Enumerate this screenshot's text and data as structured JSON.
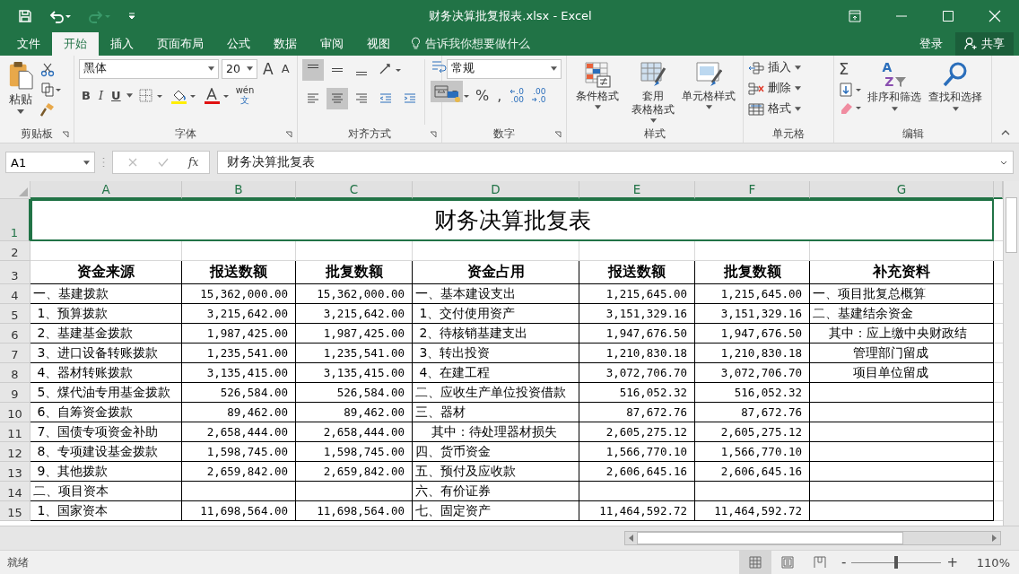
{
  "window": {
    "title": "财务决算批复报表.xlsx - Excel"
  },
  "tabs": [
    {
      "label": "文件",
      "selected": false
    },
    {
      "label": "开始",
      "selected": true
    },
    {
      "label": "插入",
      "selected": false
    },
    {
      "label": "页面布局",
      "selected": false
    },
    {
      "label": "公式",
      "selected": false
    },
    {
      "label": "数据",
      "selected": false
    },
    {
      "label": "审阅",
      "selected": false
    },
    {
      "label": "视图",
      "selected": false
    }
  ],
  "tell_me": {
    "placeholder": "告诉我你想要做什么"
  },
  "account": {
    "sign_in": "登录",
    "share": "共享"
  },
  "ribbon": {
    "clipboard": {
      "label": "剪贴板",
      "paste": "粘贴"
    },
    "font": {
      "label": "字体",
      "font_name": "黑体",
      "font_size": "20",
      "grow": "A",
      "shrink": "A",
      "bold": "B",
      "italic": "I",
      "underline": "U",
      "phonetic_top": "wén",
      "phonetic_bottom": "文"
    },
    "alignment": {
      "label": "对齐方式",
      "top_row": [
        {
          "kind": "top",
          "selected": true
        },
        {
          "kind": "middle",
          "selected": false
        },
        {
          "kind": "bottom",
          "selected": false
        }
      ],
      "bottom_row": [
        {
          "kind": "left",
          "selected": false
        },
        {
          "kind": "center",
          "selected": true
        },
        {
          "kind": "right",
          "selected": false
        },
        {
          "kind": "outdent",
          "selected": false
        },
        {
          "kind": "indent",
          "selected": false
        }
      ],
      "merge_selected": true
    },
    "number": {
      "label": "数字",
      "format": "常规",
      "percent": "%",
      "comma": ",",
      "increase_decimal": [
        ".0",
        ".00"
      ],
      "decrease_decimal": [
        ".00",
        ".0"
      ]
    },
    "styles": {
      "label": "样式",
      "buttons": [
        {
          "kind": "conditional",
          "lines": [
            "条件格式"
          ]
        },
        {
          "kind": "table",
          "lines": [
            "套用",
            "表格格式"
          ]
        },
        {
          "kind": "cell",
          "lines": [
            "单元格样式"
          ]
        }
      ]
    },
    "cells": {
      "label": "单元格",
      "buttons": [
        {
          "kind": "insert",
          "label": "插入"
        },
        {
          "kind": "delete",
          "label": "删除"
        },
        {
          "kind": "format",
          "label": "格式"
        }
      ]
    },
    "editing": {
      "label": "编辑",
      "sum": "Σ",
      "sort_letters": [
        "A",
        "Z"
      ],
      "sort": "排序和筛选",
      "find": "查找和选择"
    }
  },
  "formula_bar": {
    "name_box": "A1",
    "fx": "fx",
    "value": "财务决算批复表"
  },
  "columns": [
    "A",
    "B",
    "C",
    "D",
    "E",
    "F",
    "G"
  ],
  "title_row": {
    "num": "1",
    "text": "财务决算批复表"
  },
  "rows": [
    {
      "num": "2",
      "kind": "blank",
      "cells": {}
    },
    {
      "num": "3",
      "kind": "header",
      "cells": {
        "A": "资金来源",
        "B": "报送数额",
        "C": "批复数额",
        "D": "资金占用",
        "E": "报送数额",
        "F": "批复数额",
        "G": "补充资料"
      }
    },
    {
      "num": "4",
      "kind": "data",
      "cells": {
        "A": "一、基建拨款",
        "B": "15,362,000.00",
        "C": "15,362,000.00",
        "D": "一、基本建设支出",
        "E": "1,215,645.00",
        "F": "1,215,645.00",
        "G": "一、项目批复总概算"
      }
    },
    {
      "num": "5",
      "kind": "data",
      "cells": {
        "A": " 1、预算拨款",
        "B": "3,215,642.00",
        "C": "3,215,642.00",
        "D": " 1、交付使用资产",
        "E": "3,151,329.16",
        "F": "3,151,329.16",
        "G": "二、基建结余资金"
      }
    },
    {
      "num": "6",
      "kind": "data",
      "cells": {
        "A": " 2、基建基金拨款",
        "B": "1,987,425.00",
        "C": "1,987,425.00",
        "D": " 2、待核销基建支出",
        "E": "1,947,676.50",
        "F": "1,947,676.50",
        "G": "    其中：应上缴中央财政结"
      }
    },
    {
      "num": "7",
      "kind": "data",
      "cells": {
        "A": " 3、进口设备转账拨款",
        "B": "1,235,541.00",
        "C": "1,235,541.00",
        "D": " 3、转出投资",
        "E": "1,210,830.18",
        "F": "1,210,830.18",
        "G": "          管理部门留成"
      }
    },
    {
      "num": "8",
      "kind": "data",
      "cells": {
        "A": " 4、器材转账拨款",
        "B": "3,135,415.00",
        "C": "3,135,415.00",
        "D": " 4、在建工程",
        "E": "3,072,706.70",
        "F": "3,072,706.70",
        "G": "          项目单位留成"
      }
    },
    {
      "num": "9",
      "kind": "data",
      "cells": {
        "A": " 5、煤代油专用基金拨款",
        "B": "526,584.00",
        "C": "526,584.00",
        "D": "二、应收生产单位投资借款",
        "E": "516,052.32",
        "F": "516,052.32"
      }
    },
    {
      "num": "10",
      "kind": "data",
      "cells": {
        "A": " 6、自筹资金拨款",
        "B": "89,462.00",
        "C": "89,462.00",
        "D": "三、器材",
        "E": "87,672.76",
        "F": "87,672.76"
      }
    },
    {
      "num": "11",
      "kind": "data",
      "cells": {
        "A": " 7、国债专项资金补助",
        "B": "2,658,444.00",
        "C": "2,658,444.00",
        "D": "    其中：待处理器材损失",
        "E": "2,605,275.12",
        "F": "2,605,275.12"
      }
    },
    {
      "num": "12",
      "kind": "data",
      "cells": {
        "A": " 8、专项建设基金拨款",
        "B": "1,598,745.00",
        "C": "1,598,745.00",
        "D": "四、货币资金",
        "E": "1,566,770.10",
        "F": "1,566,770.10"
      }
    },
    {
      "num": "13",
      "kind": "data",
      "cells": {
        "A": " 9、其他拨款",
        "B": "2,659,842.00",
        "C": "2,659,842.00",
        "D": "五、预付及应收款",
        "E": "2,606,645.16",
        "F": "2,606,645.16"
      }
    },
    {
      "num": "14",
      "kind": "data",
      "cells": {
        "A": "二、项目资本",
        "D": "六、有价证券"
      }
    },
    {
      "num": "15",
      "kind": "data",
      "cells": {
        "A": " 1、国家资本",
        "B": "11,698,564.00",
        "C": "11,698,564.00",
        "D": "七、固定资产",
        "E": "11,464,592.72",
        "F": "11,464,592.72"
      }
    }
  ],
  "status_bar": {
    "text": "就绪",
    "views": [
      {
        "kind": "normal",
        "selected": true
      },
      {
        "kind": "page_layout",
        "selected": false
      },
      {
        "kind": "page_break",
        "selected": false
      }
    ],
    "zoom_out": "-",
    "zoom_in": "+",
    "zoom": "110%",
    "zoom_slider": {
      "level": 0.5
    }
  }
}
